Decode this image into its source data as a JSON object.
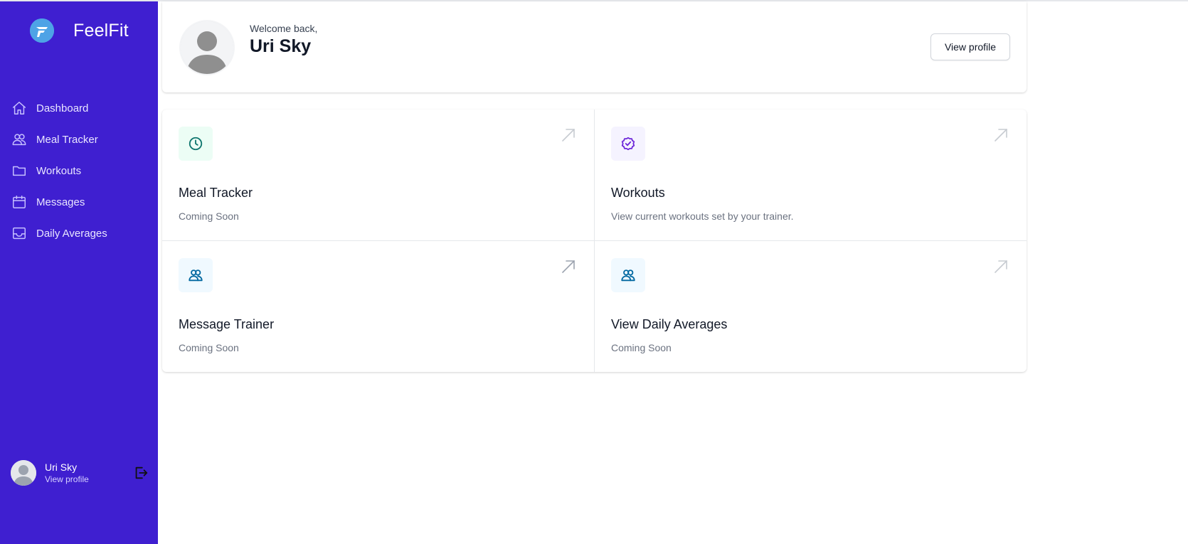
{
  "brand": {
    "name": "FeelFit"
  },
  "nav": [
    {
      "label": "Dashboard",
      "icon": "home-icon"
    },
    {
      "label": "Meal Tracker",
      "icon": "users-icon"
    },
    {
      "label": "Workouts",
      "icon": "folder-icon"
    },
    {
      "label": "Messages",
      "icon": "calendar-icon"
    },
    {
      "label": "Daily Averages",
      "icon": "inbox-icon"
    }
  ],
  "sidebar_user": {
    "name": "Uri Sky",
    "link": "View profile"
  },
  "header": {
    "welcome": "Welcome back,",
    "name": "Uri Sky",
    "button": "View profile"
  },
  "cards": [
    {
      "title": "Meal Tracker",
      "description": "Coming Soon",
      "icon": "clock-icon",
      "tile_color": "#ecfdf5",
      "icon_color": "#0f766e"
    },
    {
      "title": "Workouts",
      "description": "View current workouts set by your trainer.",
      "icon": "badge-check-icon",
      "tile_color": "#f5f3ff",
      "icon_color": "#6d28d9"
    },
    {
      "title": "Message Trainer",
      "description": "Coming Soon",
      "icon": "users-icon",
      "tile_color": "#f0f9ff",
      "icon_color": "#0369a1"
    },
    {
      "title": "View Daily Averages",
      "description": "Coming Soon",
      "icon": "users-icon",
      "tile_color": "#f0f9ff",
      "icon_color": "#0369a1"
    }
  ],
  "colors": {
    "sidebar": "#3f1fd0",
    "logo": "#4ea3e6"
  }
}
